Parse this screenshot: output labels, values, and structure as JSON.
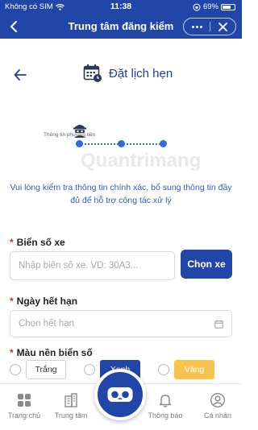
{
  "status_bar": {
    "carrier": "Không có SIM",
    "time": "11:38",
    "battery": "69%",
    "battery_level": 0.69
  },
  "header": {
    "title": "Trung tâm đăng kiểm",
    "back_icon": "chevron-left-icon",
    "more_icon": "more-dots-icon",
    "close_icon": "close-icon"
  },
  "page": {
    "title": "Đặt lịch hẹn",
    "title_icon": "calendar-clock-icon",
    "back_icon": "arrow-left-icon"
  },
  "stepper": {
    "step_label": "Thông tin phương tiện",
    "steps": 3,
    "current": 1
  },
  "notice": "Vui lòng kiểm tra thông tin chính xác, bổ sung thông tin đầy đủ để hỗ trợ công tác xử lý",
  "watermark": "Quantrimang",
  "form": {
    "plate": {
      "label": "Biển số xe",
      "placeholder": "Nhập biển số xe. VD: 30A3...",
      "value": "",
      "button": "Chọn xe"
    },
    "expiry": {
      "label": "Ngày hết hạn",
      "placeholder": "Chọn hết hạn"
    },
    "plate_color": {
      "label": "Màu nền biển số",
      "options": [
        {
          "label": "Trắng",
          "color": "#ffffff",
          "selected": false
        },
        {
          "label": "Xanh",
          "color": "#2245a8",
          "selected": false
        },
        {
          "label": "Vàng",
          "color": "#f6c44c",
          "selected": false
        }
      ]
    }
  },
  "bottom_nav": {
    "items": [
      {
        "label": "Trang chủ",
        "icon": "home-grid-icon"
      },
      {
        "label": "Trung tâm",
        "icon": "building-icon"
      },
      {
        "label": "Thông báo",
        "icon": "bell-icon"
      },
      {
        "label": "Cá nhân",
        "icon": "user-icon"
      }
    ],
    "center_icon": "vr-goggles-icon"
  },
  "colors": {
    "primary": "#2245a8",
    "accent_text": "#2a5bc4",
    "required": "#e02020"
  }
}
